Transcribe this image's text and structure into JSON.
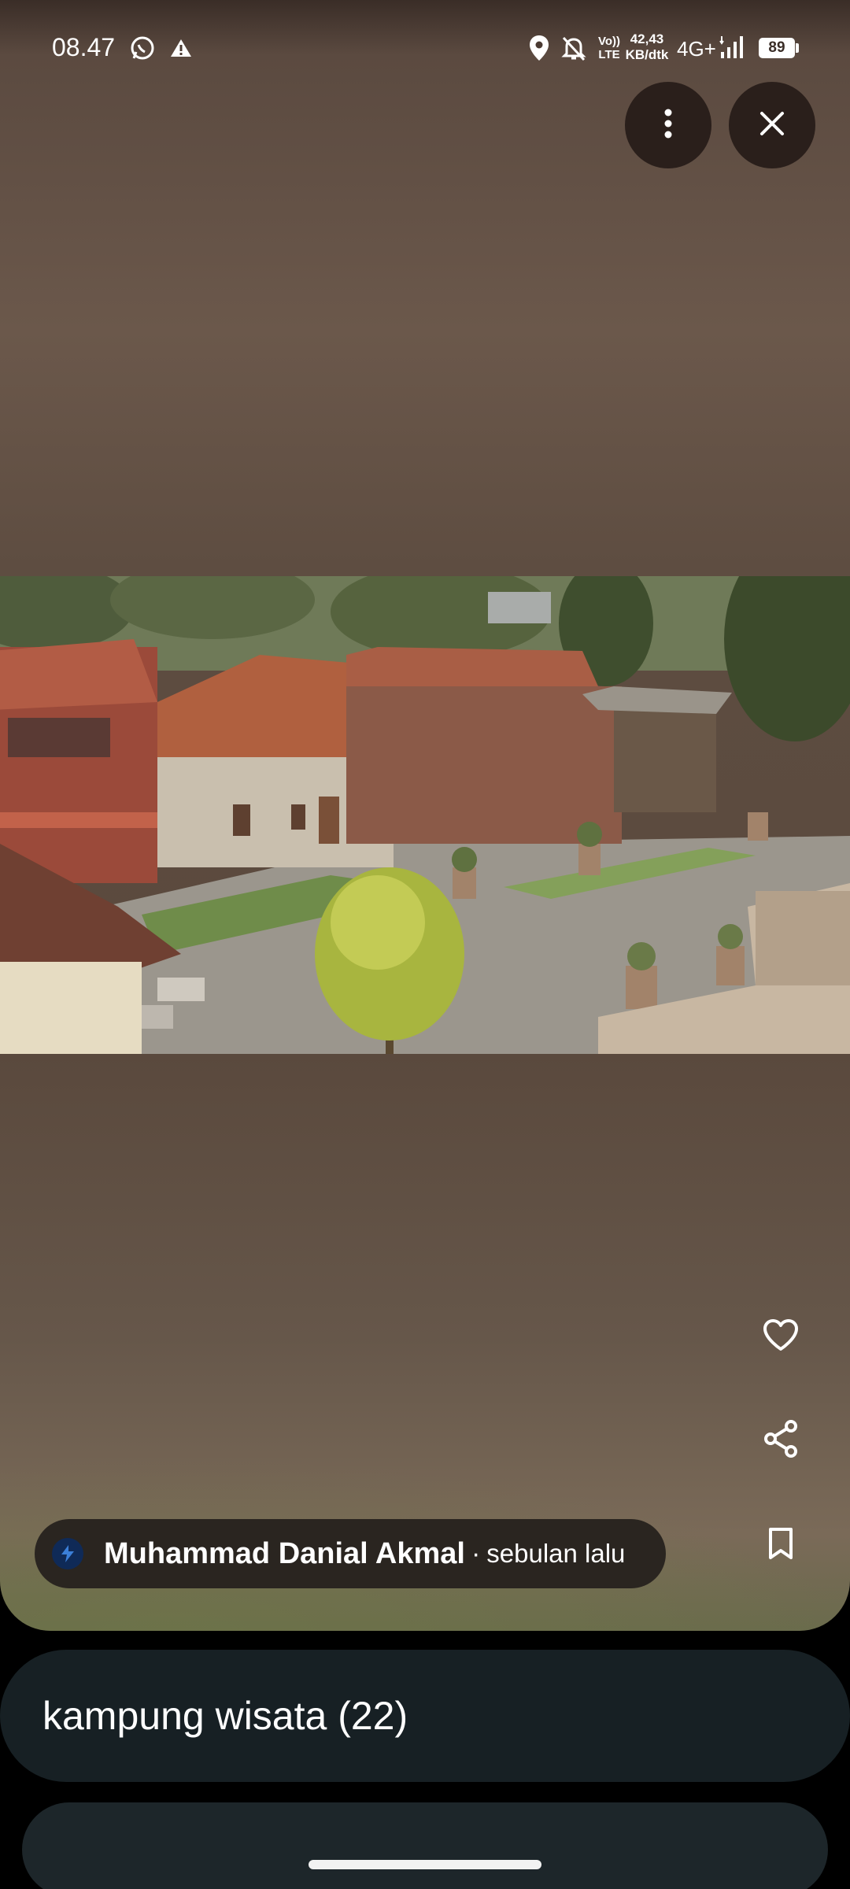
{
  "status_bar": {
    "time": "08.47",
    "volte": "Vo))",
    "lte": "LTE",
    "speed_value": "42,43",
    "speed_unit": "KB/dtk",
    "network": "4G+",
    "battery": "89"
  },
  "toolbar": {
    "more_icon": "more-vert-icon",
    "close_icon": "close-icon"
  },
  "actions": {
    "like_icon": "heart-icon",
    "share_icon": "share-icon",
    "save_icon": "bookmark-icon"
  },
  "author": {
    "name": "Muhammad Danial Akmal",
    "separator": "·",
    "time_ago": "sebulan lalu"
  },
  "album": {
    "title": "kampung wisata (22)"
  },
  "colors": {
    "background": "#000000",
    "card": "#172024",
    "button": "#2a1f1b"
  }
}
